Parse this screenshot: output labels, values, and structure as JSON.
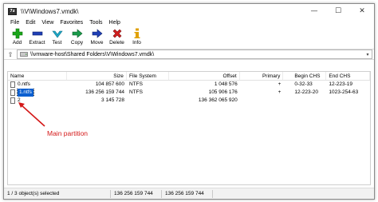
{
  "window": {
    "icon_text": "7z",
    "title": "\\\\V\\Windows7.vmdk\\",
    "controls": {
      "minimize": "—",
      "maximize": "☐",
      "close": "✕"
    }
  },
  "menu": [
    "File",
    "Edit",
    "View",
    "Favorites",
    "Tools",
    "Help"
  ],
  "toolbar": [
    {
      "label": "Add",
      "icon": "plus-icon",
      "color": "#1aa51a"
    },
    {
      "label": "Extract",
      "icon": "minus-icon",
      "color": "#1f3fb5"
    },
    {
      "label": "Test",
      "icon": "check-icon",
      "color": "#1ea8c8"
    },
    {
      "label": "Copy",
      "icon": "copy-arrow-icon",
      "color": "#1a9a4a"
    },
    {
      "label": "Move",
      "icon": "move-arrow-icon",
      "color": "#1f3fb5"
    },
    {
      "label": "Delete",
      "icon": "x-icon",
      "color": "#d42020"
    },
    {
      "label": "Info",
      "icon": "info-icon",
      "color": "#e0a000"
    }
  ],
  "address": {
    "up_icon": "up-folder-icon",
    "path": "\\\\vmware-host\\Shared Folders\\V\\Windows7.vmdk\\"
  },
  "columns": {
    "name": "Name",
    "size": "Size",
    "file_system": "File System",
    "offset": "Offset",
    "primary": "Primary",
    "begin_chs": "Begin CHS",
    "end_chs": "End CHS"
  },
  "rows": [
    {
      "name": "0.ntfs",
      "size": "104 857 600",
      "file_system": "NTFS",
      "offset": "1 048 576",
      "primary": "+",
      "begin_chs": "0-32-33",
      "end_chs": "12-223-19"
    },
    {
      "name": "1.ntfs",
      "size": "136 256 159 744",
      "file_system": "NTFS",
      "offset": "105 906 176",
      "primary": "+",
      "begin_chs": "12-223-20",
      "end_chs": "1023-254-63"
    },
    {
      "name": "2",
      "size": "3 145 728",
      "file_system": "",
      "offset": "136 362 065 920",
      "primary": "",
      "begin_chs": "",
      "end_chs": ""
    }
  ],
  "selected_row": 1,
  "annotation": {
    "text": "Main partition",
    "color": "#d41818"
  },
  "status": {
    "selected": "1 / 3 object(s) selected",
    "size": "136 256 159 744",
    "total": "136 256 159 744"
  }
}
